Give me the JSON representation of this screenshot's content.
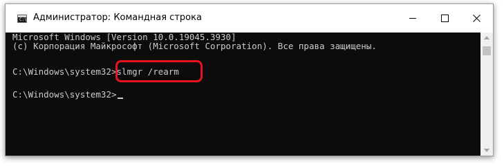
{
  "window": {
    "title": "Администратор: Командная строка",
    "icon": "command-prompt-icon",
    "controls": {
      "minimize_icon": "minimize-icon",
      "maximize_icon": "maximize-icon",
      "close_icon": "close-icon"
    }
  },
  "console": {
    "lines": [
      "Microsoft Windows [Version 10.0.19045.3930]",
      "(c) Корпорация Майкрософт (Microsoft Corporation). Все права защищены.",
      "C:\\Windows\\system32>slmgr /rearm",
      "C:\\Windows\\system32>"
    ],
    "text_color": "#cccccc",
    "background_color": "#0c0c0c"
  },
  "highlight": {
    "color": "#e8141b",
    "target": "slmgr /rearm"
  }
}
